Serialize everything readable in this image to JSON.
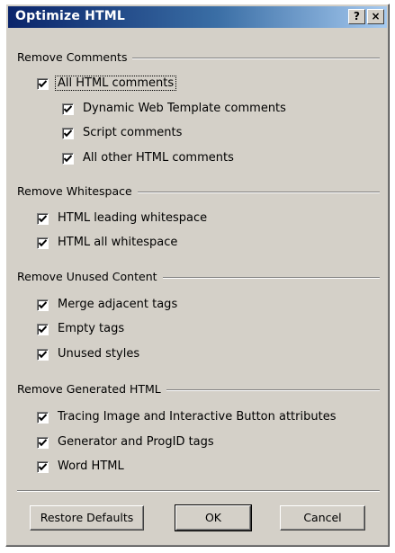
{
  "dialog": {
    "title": "Optimize HTML",
    "help_button": "?",
    "close_button": "×"
  },
  "groups": {
    "comments": {
      "label": "Remove Comments",
      "all_html_comments": {
        "label": "All HTML comments",
        "checked": true
      },
      "dynamic_web_template": {
        "label": "Dynamic Web Template comments",
        "checked": true
      },
      "script_comments": {
        "label": "Script comments",
        "checked": true
      },
      "all_other_html_comments": {
        "label": "All other HTML comments",
        "checked": true
      }
    },
    "whitespace": {
      "label": "Remove Whitespace",
      "html_leading_whitespace": {
        "label": "HTML leading whitespace",
        "checked": true
      },
      "html_all_whitespace": {
        "label": "HTML all whitespace",
        "checked": true
      }
    },
    "unused": {
      "label": "Remove Unused Content",
      "merge_adjacent_tags": {
        "label": "Merge adjacent tags",
        "checked": true
      },
      "empty_tags": {
        "label": "Empty tags",
        "checked": true
      },
      "unused_styles": {
        "label": "Unused styles",
        "checked": true
      }
    },
    "generated": {
      "label": "Remove Generated HTML",
      "tracing_image": {
        "label": "Tracing Image and Interactive Button attributes",
        "checked": true
      },
      "generator_progid": {
        "label": "Generator and ProgID tags",
        "checked": true
      },
      "word_html": {
        "label": "Word HTML",
        "checked": true
      }
    }
  },
  "buttons": {
    "restore_defaults": "Restore Defaults",
    "ok": "OK",
    "cancel": "Cancel"
  }
}
